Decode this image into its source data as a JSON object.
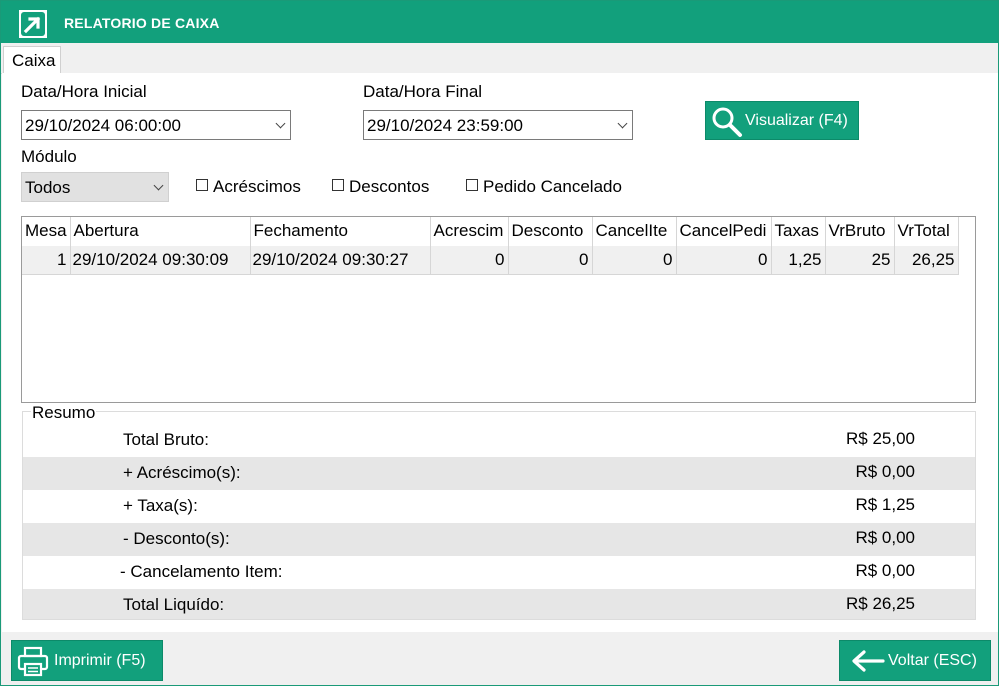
{
  "window": {
    "title": "RELATORIO DE CAIXA",
    "accent": "#12a07c"
  },
  "tabs": [
    {
      "label": "Caixa"
    }
  ],
  "filters": {
    "start_label": "Data/Hora Inicial",
    "start_value": "29/10/2024 06:00:00",
    "end_label": "Data/Hora Final",
    "end_value": "29/10/2024 23:59:00",
    "module_label": "Módulo",
    "module_value": "Todos",
    "view_button": "Visualizar (F4)",
    "checks": [
      {
        "label": "Acréscimos",
        "checked": false
      },
      {
        "label": "Descontos",
        "checked": false
      },
      {
        "label": "Pedido Cancelado",
        "checked": false
      }
    ]
  },
  "grid": {
    "columns": [
      "Mesa",
      "Abertura",
      "Fechamento",
      "Acrescim",
      "Desconto",
      "CancelIte",
      "CancelPedi",
      "Taxas",
      "VrBruto",
      "VrTotal"
    ],
    "rows": [
      [
        "1",
        "29/10/2024 09:30:09",
        "29/10/2024 09:30:27",
        "0",
        "0",
        "0",
        "0",
        "1,25",
        "25",
        "26,25"
      ]
    ]
  },
  "resumo": {
    "title": "Resumo",
    "rows": [
      {
        "label": "Total Bruto:",
        "value": "R$ 25,00"
      },
      {
        "label": "+ Acréscimo(s):",
        "value": "R$ 0,00"
      },
      {
        "label": "+ Taxa(s):",
        "value": "R$ 1,25"
      },
      {
        "label": "- Desconto(s):",
        "value": "R$ 0,00"
      },
      {
        "label": "- Cancelamento Item:",
        "value": "R$ 0,00"
      },
      {
        "label": "Total Liquído:",
        "value": "R$ 26,25"
      }
    ]
  },
  "footer": {
    "print_button": "Imprimir (F5)",
    "back_button": "Voltar (ESC)"
  }
}
